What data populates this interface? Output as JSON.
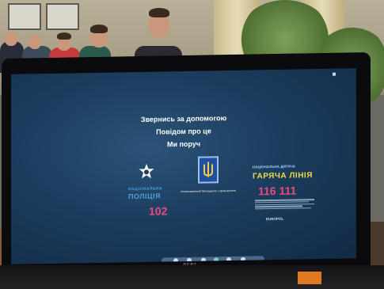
{
  "screen": {
    "lines": [
      "Звернись за допомогою",
      "Повідом про це",
      "Ми поруч"
    ],
    "police": {
      "label_top": "НАЦІОНАЛЬНА",
      "label_bottom": "ПОЛІЦІЯ",
      "number": "102"
    },
    "ombudsman_caption": "Уповноважений Президента з прав дитини",
    "hotline": {
      "top": "НАЦІОНАЛЬНА ДИТЯЧА",
      "title": "ГАРЯЧА ЛІНІЯ",
      "number": "116 111",
      "partner": "EUROPOL"
    }
  },
  "laptop": {
    "brand": "acer"
  },
  "colors": {
    "screen_bg": "#1c3d5e",
    "police_blue": "#4da0df",
    "number_pink": "#e84a7e",
    "hotline_yellow": "#f1d94a",
    "bezel": "#0b0b0e"
  },
  "icons": [
    "police-star-icon",
    "ukraine-trident-emblem-icon"
  ]
}
